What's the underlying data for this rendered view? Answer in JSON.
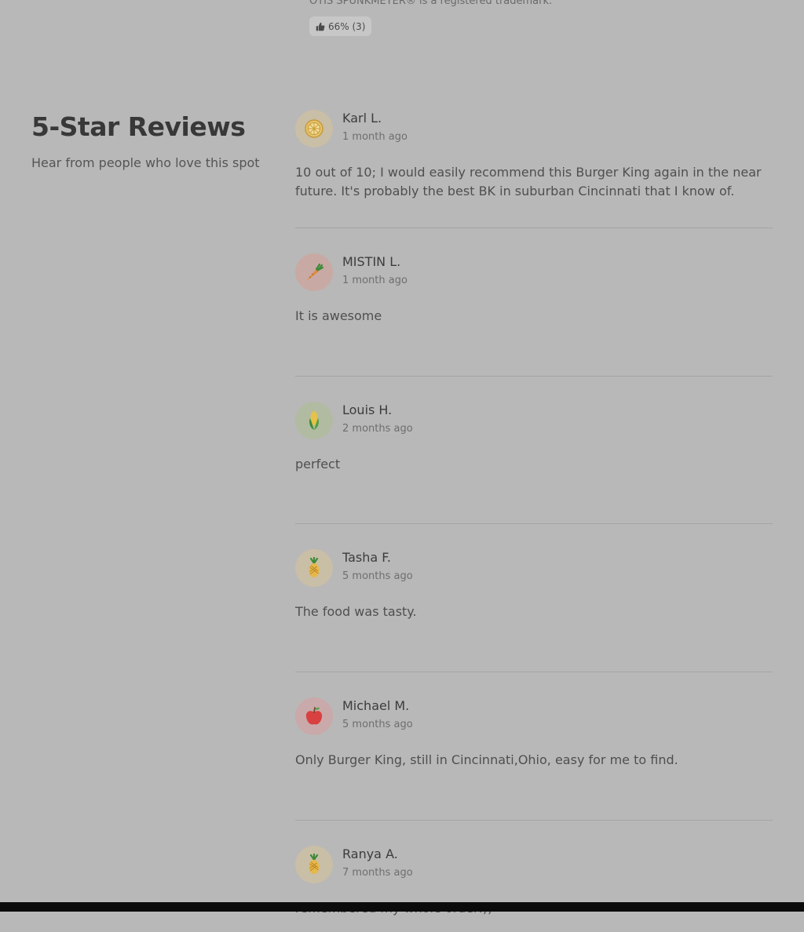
{
  "top": {
    "trademark_note": "OTIS SPUNKMEYER® is a registered trademark.",
    "vote_label": "66% (3)",
    "vote_icon": "thumbs-up-icon"
  },
  "section": {
    "title": "5-Star Reviews",
    "subtitle": "Hear from people who love this spot"
  },
  "reviews": [
    {
      "name": "Karl L.",
      "time": "1 month ago",
      "text": "10 out of 10; I would easily recommend this Burger King again in the near future. It's probably the best BK in suburban Cincinnati that I know of.",
      "avatar_icon": "lemon-icon",
      "avatar_bg": "#c9bea6"
    },
    {
      "name": "MISTIN L.",
      "time": "1 month ago",
      "text": "It is awesome",
      "avatar_icon": "carrot-icon",
      "avatar_bg": "#c9a9a4"
    },
    {
      "name": "Louis H.",
      "time": "2 months ago",
      "text": "perfect",
      "avatar_icon": "corn-icon",
      "avatar_bg": "#b1bba1"
    },
    {
      "name": "Tasha F.",
      "time": "5 months ago",
      "text": "The food was tasty.",
      "avatar_icon": "pineapple-icon",
      "avatar_bg": "#c9bea6"
    },
    {
      "name": "Michael M.",
      "time": "5 months ago",
      "text": "Only Burger King, still in Cincinnati,Ohio, easy for me to find.",
      "avatar_icon": "apple-icon",
      "avatar_bg": "#c9a9a9"
    },
    {
      "name": "Ranya A.",
      "time": "7 months ago",
      "text": "remembered my whole order:))",
      "avatar_icon": "pineapple-icon",
      "avatar_bg": "#c9bea6"
    }
  ]
}
